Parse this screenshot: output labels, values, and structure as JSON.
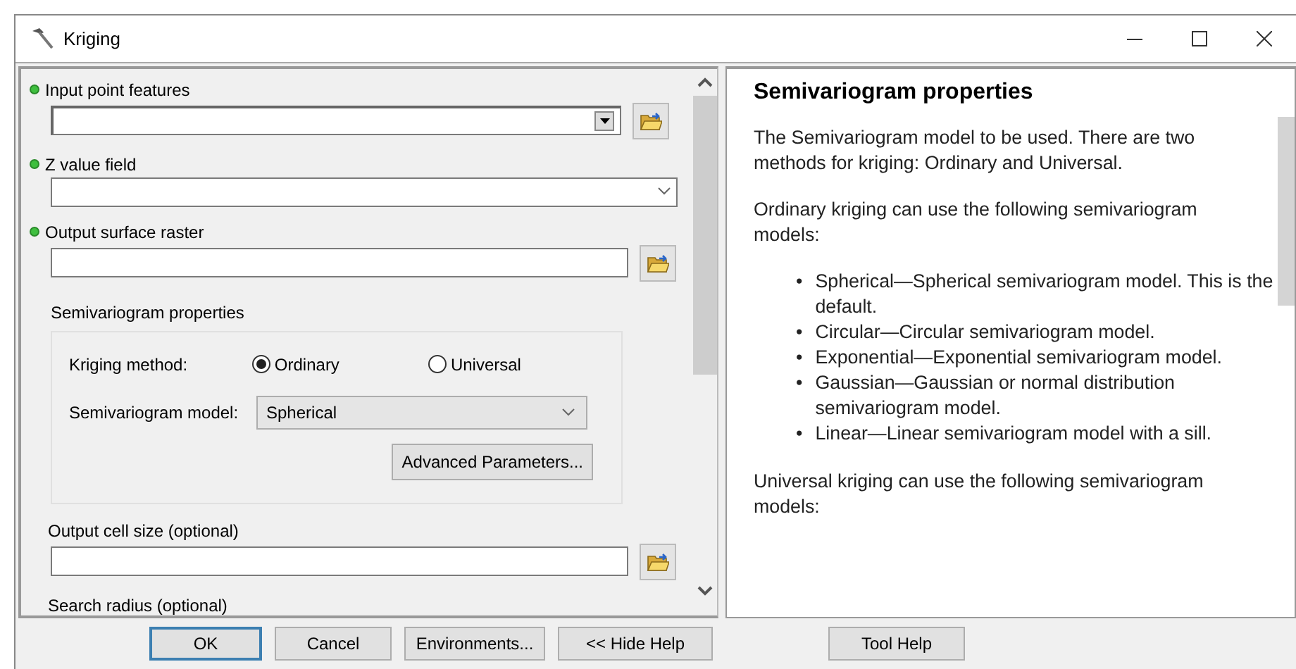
{
  "window": {
    "title": "Kriging"
  },
  "parameters": [
    {
      "kind": "combo",
      "label": "Input point features",
      "required": true,
      "browse": true
    },
    {
      "kind": "dropdown",
      "label": "Z value field",
      "required": true,
      "browse": false
    },
    {
      "kind": "text",
      "label": "Output surface raster",
      "required": true,
      "browse": true
    },
    {
      "kind": "group",
      "label": "Semivariogram properties",
      "required": false,
      "method_label": "Kriging method:",
      "methods": [
        {
          "label": "Ordinary",
          "selected": true
        },
        {
          "label": "Universal",
          "selected": false
        }
      ],
      "model_label": "Semivariogram model:",
      "model": "Spherical",
      "button": "Advanced Parameters..."
    },
    {
      "kind": "text",
      "label": "Output cell size (optional)",
      "required": false,
      "browse": true
    },
    {
      "kind": "label",
      "label": "Search radius (optional)",
      "required": false
    }
  ],
  "help": {
    "title": "Semivariogram properties",
    "blocks": [
      {
        "kind": "paragraph",
        "text": "The Semivariogram model to be used. There are two methods for kriging: Ordinary and Universal."
      },
      {
        "kind": "paragraph",
        "text": "Ordinary kriging can use the following semivariogram models:"
      },
      {
        "kind": "list",
        "bullet": "•",
        "items": [
          "Spherical—Spherical semivariogram model. This is the default.",
          "Circular—Circular semivariogram model.",
          "Exponential—Exponential semivariogram model.",
          "Gaussian—Gaussian or normal distribution semivariogram model.",
          "Linear—Linear semivariogram model with a sill."
        ]
      },
      {
        "kind": "paragraph",
        "text": "Universal kriging can use the following semivariogram models:"
      }
    ]
  },
  "buttons": [
    {
      "label": "OK",
      "default": true
    },
    {
      "label": "Cancel",
      "default": false
    },
    {
      "label": "Environments...",
      "default": false
    },
    {
      "label": "<< Hide Help",
      "default": false
    },
    {
      "label": "Tool Help",
      "default": false
    }
  ]
}
